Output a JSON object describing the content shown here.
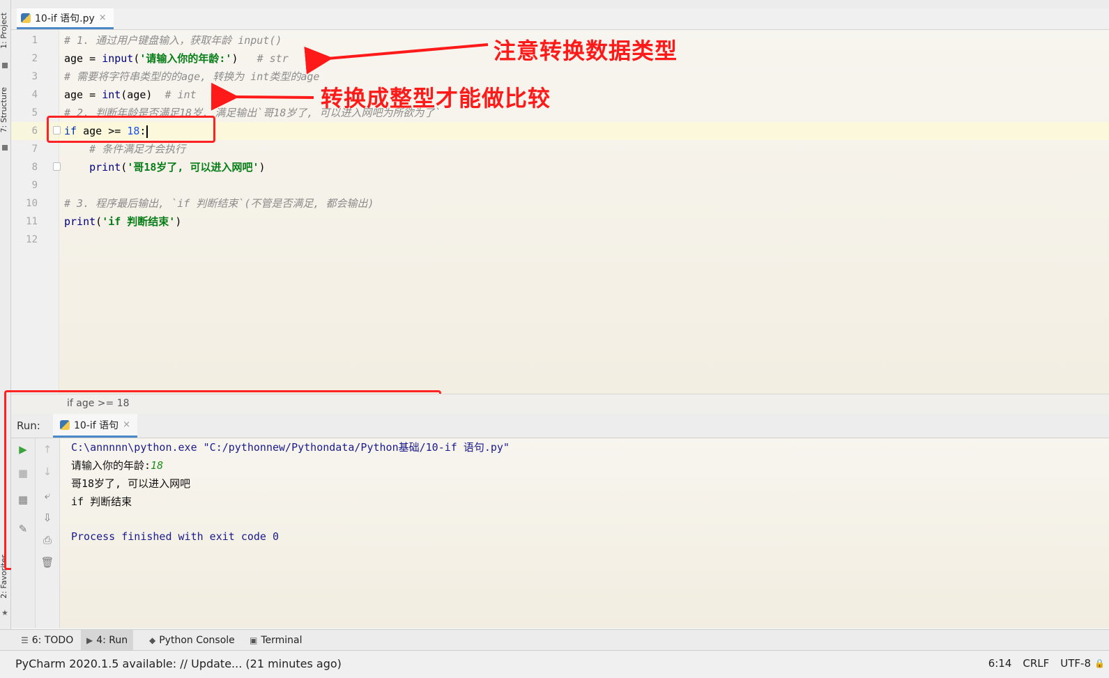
{
  "left_tool_tabs": {
    "project": "1: Project",
    "structure": "7: Structure",
    "favorites": "2: Favorites"
  },
  "editor_tab": {
    "filename": "10-if 语句.py",
    "close": "×"
  },
  "code_lines": [
    {
      "n": "1",
      "segments": [
        {
          "cls": "c-com",
          "t": "# 1. 通过用户键盘输入，获取年龄 input()"
        }
      ]
    },
    {
      "n": "2",
      "segments": [
        {
          "cls": "",
          "t": "age = "
        },
        {
          "cls": "c-fn",
          "t": "input"
        },
        {
          "cls": "",
          "t": "("
        },
        {
          "cls": "c-str",
          "t": "'请输入你的年龄:'"
        },
        {
          "cls": "",
          "t": ")   "
        },
        {
          "cls": "c-com",
          "t": "# str"
        }
      ]
    },
    {
      "n": "3",
      "segments": [
        {
          "cls": "c-com",
          "t": "# 需要将字符串类型的的age, 转换为 int类型的age"
        }
      ]
    },
    {
      "n": "4",
      "segments": [
        {
          "cls": "",
          "t": "age = "
        },
        {
          "cls": "c-fn",
          "t": "int"
        },
        {
          "cls": "",
          "t": "(age)  "
        },
        {
          "cls": "c-com",
          "t": "# int"
        }
      ]
    },
    {
      "n": "5",
      "segments": [
        {
          "cls": "c-com",
          "t": "# 2. 判断年龄是否满足18岁, 满足输出`哥18岁了, 可以进入网吧为所欲为了`"
        }
      ]
    },
    {
      "n": "6",
      "segments": [
        {
          "cls": "c-kw",
          "t": "if"
        },
        {
          "cls": "",
          "t": " age >= "
        },
        {
          "cls": "c-num",
          "t": "18"
        },
        {
          "cls": "",
          "t": ":"
        }
      ]
    },
    {
      "n": "7",
      "segments": [
        {
          "cls": "",
          "t": "    "
        },
        {
          "cls": "c-com",
          "t": "# 条件满足才会执行"
        }
      ]
    },
    {
      "n": "8",
      "segments": [
        {
          "cls": "",
          "t": "    "
        },
        {
          "cls": "c-fn",
          "t": "print"
        },
        {
          "cls": "",
          "t": "("
        },
        {
          "cls": "c-str",
          "t": "'哥18岁了, 可以进入网吧'"
        },
        {
          "cls": "",
          "t": ")"
        }
      ]
    },
    {
      "n": "9",
      "segments": []
    },
    {
      "n": "10",
      "segments": [
        {
          "cls": "c-com",
          "t": "# 3. 程序最后输出, `if 判断结束`(不管是否满足, 都会输出)"
        }
      ]
    },
    {
      "n": "11",
      "segments": [
        {
          "cls": "c-fn",
          "t": "print"
        },
        {
          "cls": "",
          "t": "("
        },
        {
          "cls": "c-str",
          "t": "'if 判断结束'"
        },
        {
          "cls": "",
          "t": ")"
        }
      ]
    },
    {
      "n": "12",
      "segments": []
    }
  ],
  "annotations": {
    "note_1": "注意转换数据类型",
    "note_2": "转换成整型才能做比较"
  },
  "breadcrumb": "if age >= 18",
  "run": {
    "label": "Run:",
    "tab_name": "10-if 语句",
    "tab_close": "×",
    "console": {
      "command": "C:\\annnnn\\python.exe \"C:/pythonnew/Pythondata/Python基础/10-if 语句.py\"",
      "prompt": "请输入你的年龄:",
      "input_value": "18",
      "output_1": "哥18岁了, 可以进入网吧",
      "output_2": "if 判断结束",
      "finished": "Process finished with exit code 0"
    }
  },
  "bottom_tabs": [
    {
      "icon": "☰",
      "label": "6: TODO"
    },
    {
      "icon": "▶",
      "label": "4: Run"
    },
    {
      "icon": "◆",
      "label": "Python Console"
    },
    {
      "icon": "▣",
      "label": "Terminal"
    }
  ],
  "status": {
    "message": "PyCharm 2020.1.5 available: // Update... (21 minutes ago)",
    "position": "6:14",
    "line_sep": "CRLF",
    "encoding": "UTF-8"
  },
  "colors": {
    "annotation_red": "#ff1a1a",
    "tab_accent": "#4a88c7"
  }
}
